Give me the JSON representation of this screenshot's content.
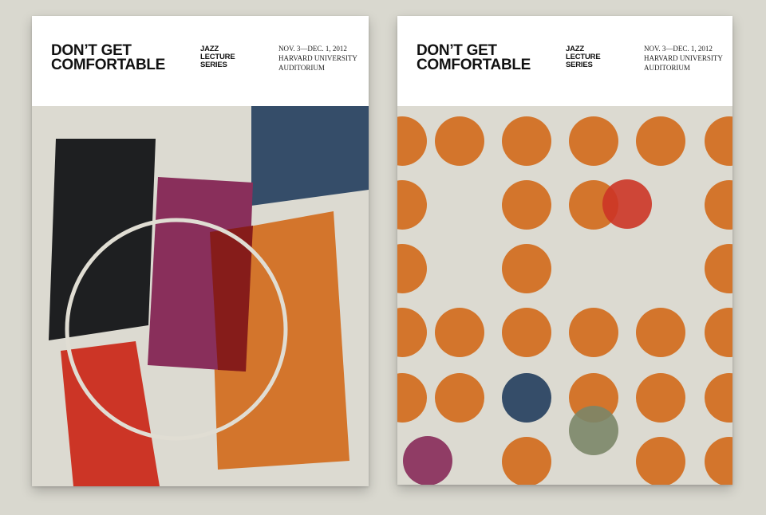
{
  "colors": {
    "background": "#d9d8cf",
    "poster_bg": "#dcdad1",
    "orange": "#d3752c",
    "black": "#1e1f21",
    "navy": "#354d69",
    "plum": "#892f5b",
    "red": "#cc3526",
    "olive": "#7b8668"
  },
  "posters": [
    {
      "title": "DON’T GET\nCOMFORTABLE",
      "series": "JAZZ\nLECTURE\nSERIES",
      "details": "NOV. 3—DEC. 1, 2012\nHARVARD UNIVERSITY\nAUDITORIUM"
    },
    {
      "title": "DON’T GET\nCOMFORTABLE",
      "series": "JAZZ\nLECTURE\nSERIES",
      "details": "NOV. 3—DEC. 1, 2012\nHARVARD UNIVERSITY\nAUDITORIUM"
    }
  ]
}
